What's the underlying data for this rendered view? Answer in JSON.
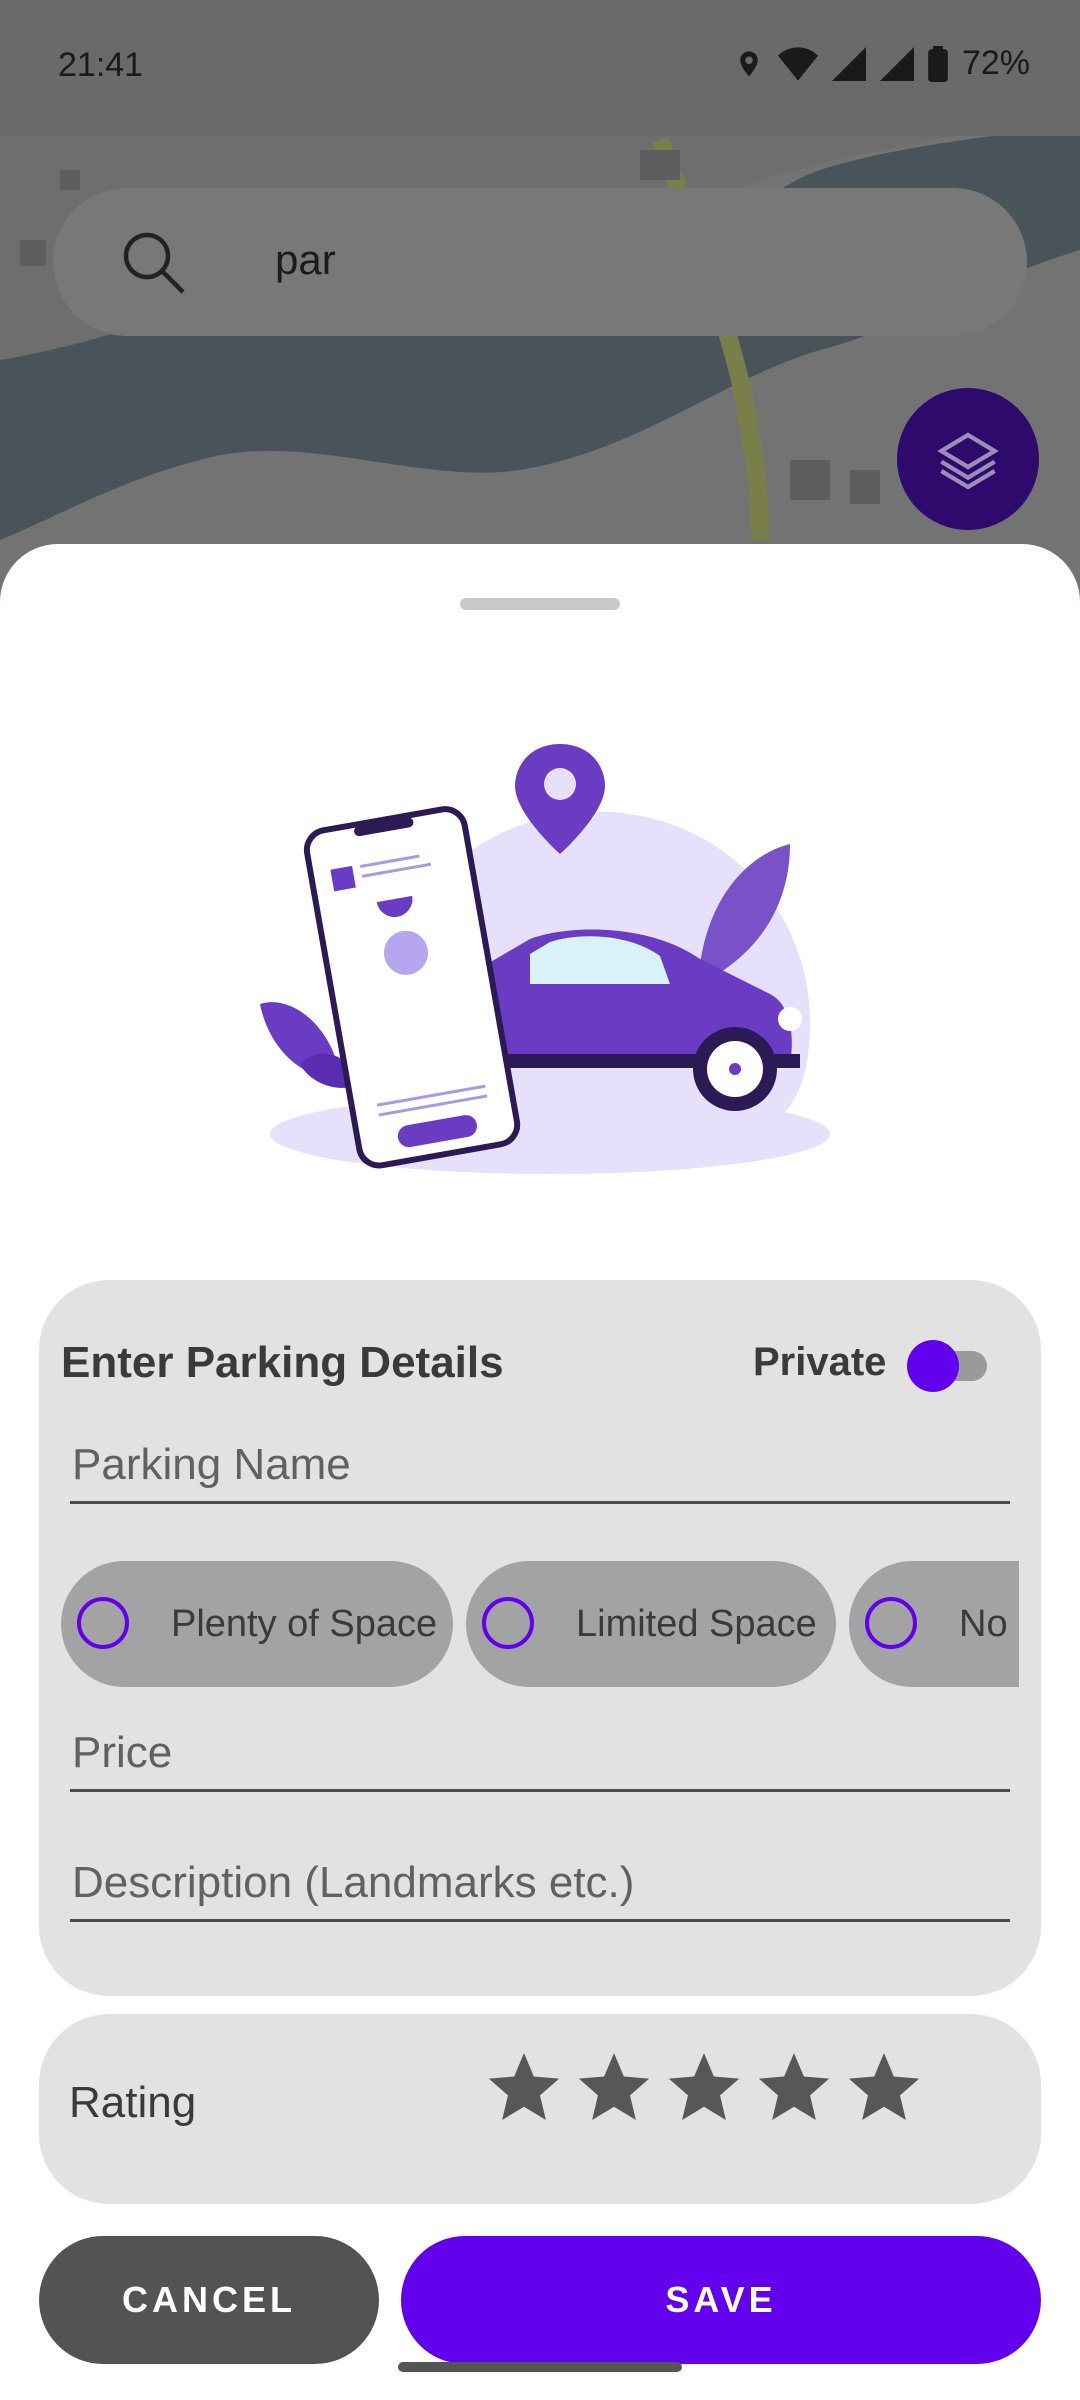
{
  "status_bar": {
    "time": "21:41",
    "battery": "72%"
  },
  "search": {
    "query": "par"
  },
  "details": {
    "title": "Enter Parking Details",
    "private_label": "Private",
    "private_on": true,
    "name_placeholder": "Parking Name",
    "space_options": [
      "Plenty of Space",
      "Limited Space",
      "No S"
    ],
    "price_placeholder": "Price",
    "description_placeholder": "Description (Landmarks etc.)"
  },
  "rating": {
    "label": "Rating",
    "stars": 5
  },
  "actions": {
    "cancel": "CANCEL",
    "save": "SAVE"
  },
  "colors": {
    "accent": "#6200ee",
    "card": "#e3e2e3",
    "cancel": "#535353"
  },
  "icons": [
    "search-icon",
    "layers-icon",
    "location-icon",
    "wifi-icon",
    "signal-icon",
    "battery-icon",
    "star-icon",
    "radio-icon"
  ]
}
